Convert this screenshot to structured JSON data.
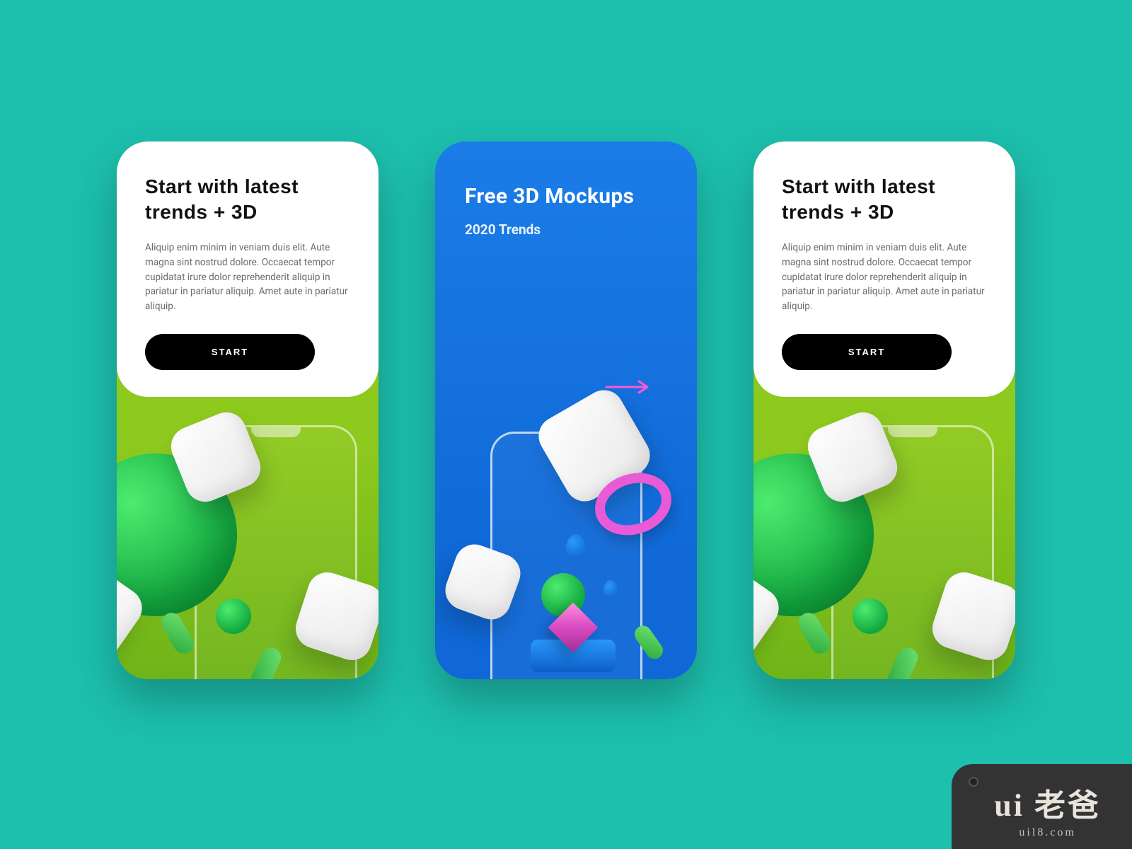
{
  "cards": {
    "left": {
      "headline": "Start with latest trends + 3D",
      "body": "Aliquip enim minim in veniam duis elit. Aute magna sint nostrud dolore. Occaecat tempor cupidatat irure dolor reprehenderit aliquip in pariatur in pariatur aliquip. Amet aute in pariatur aliquip.",
      "button": "START"
    },
    "center": {
      "title": "Free 3D Mockups",
      "subtitle": "2020 Trends"
    },
    "right": {
      "headline": "Start with latest trends + 3D",
      "body": "Aliquip enim minim in veniam duis elit. Aute magna sint nostrud dolore. Occaecat tempor cupidatat irure dolor reprehenderit aliquip in pariatur in pariatur aliquip. Amet aute in pariatur aliquip.",
      "button": "START"
    }
  },
  "watermark": {
    "brand": "ui 老爸",
    "url": "uil8.com"
  },
  "colors": {
    "background": "#1dbfad",
    "accent_pink": "#e85ad6",
    "blue": "#1b7ce8",
    "green": "#7ec41c"
  }
}
